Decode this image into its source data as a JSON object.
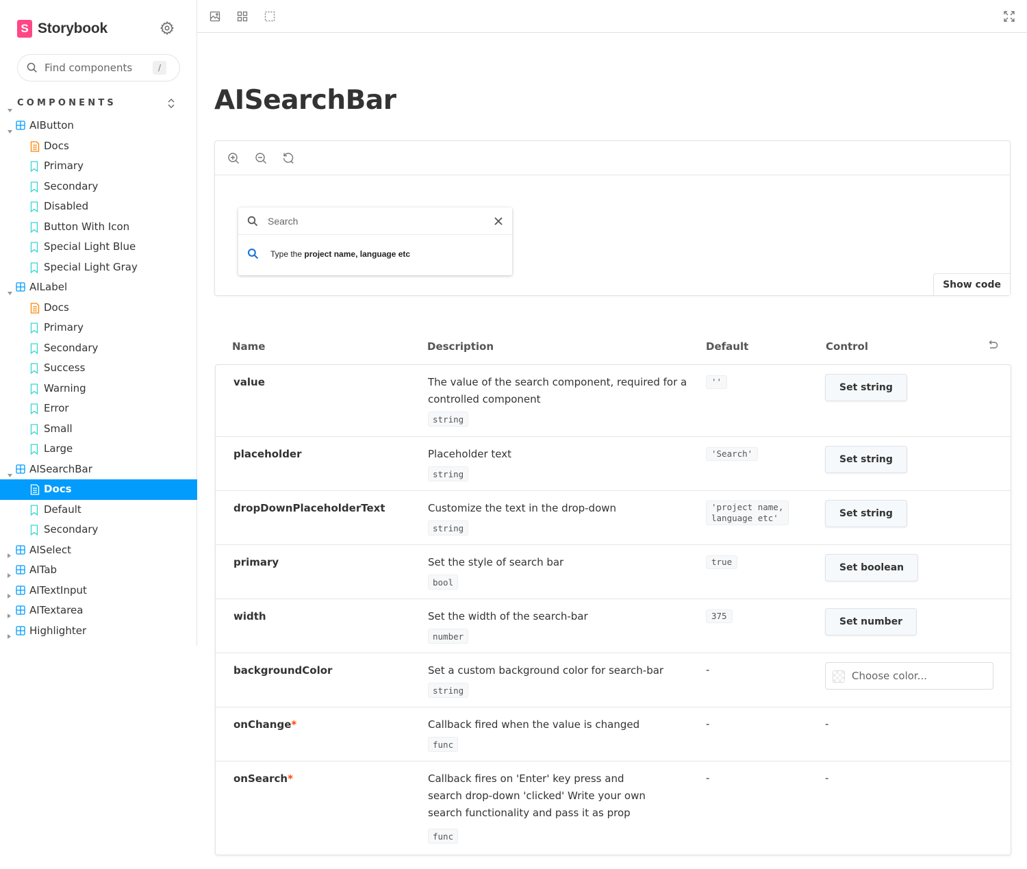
{
  "sidebar": {
    "brand": "Storybook",
    "logo_letter": "S",
    "search_placeholder": "Find components",
    "search_shortcut": "/",
    "section_title": "COMPONENTS",
    "tree": [
      {
        "label": "AIButton",
        "type": "component",
        "level": 0,
        "expanded": true
      },
      {
        "label": "Docs",
        "type": "docs",
        "level": 1
      },
      {
        "label": "Primary",
        "type": "story",
        "level": 1
      },
      {
        "label": "Secondary",
        "type": "story",
        "level": 1
      },
      {
        "label": "Disabled",
        "type": "story",
        "level": 1
      },
      {
        "label": "Button With Icon",
        "type": "story",
        "level": 1
      },
      {
        "label": "Special Light Blue",
        "type": "story",
        "level": 1
      },
      {
        "label": "Special Light Gray",
        "type": "story",
        "level": 1
      },
      {
        "label": "AILabel",
        "type": "component",
        "level": 0,
        "expanded": true
      },
      {
        "label": "Docs",
        "type": "docs",
        "level": 1
      },
      {
        "label": "Primary",
        "type": "story",
        "level": 1
      },
      {
        "label": "Secondary",
        "type": "story",
        "level": 1
      },
      {
        "label": "Success",
        "type": "story",
        "level": 1
      },
      {
        "label": "Warning",
        "type": "story",
        "level": 1
      },
      {
        "label": "Error",
        "type": "story",
        "level": 1
      },
      {
        "label": "Small",
        "type": "story",
        "level": 1
      },
      {
        "label": "Large",
        "type": "story",
        "level": 1
      },
      {
        "label": "AISearchBar",
        "type": "component",
        "level": 0,
        "expanded": true
      },
      {
        "label": "Docs",
        "type": "docs",
        "level": 1,
        "selected": true
      },
      {
        "label": "Default",
        "type": "story",
        "level": 1
      },
      {
        "label": "Secondary",
        "type": "story",
        "level": 1
      },
      {
        "label": "AISelect",
        "type": "component",
        "level": 0,
        "expanded": false
      },
      {
        "label": "AITab",
        "type": "component",
        "level": 0,
        "expanded": false
      },
      {
        "label": "AITextInput",
        "type": "component",
        "level": 0,
        "expanded": false
      },
      {
        "label": "AITextarea",
        "type": "component",
        "level": 0,
        "expanded": false
      },
      {
        "label": "Highlighter",
        "type": "component",
        "level": 0,
        "expanded": false
      }
    ]
  },
  "page": {
    "title": "AISearchBar"
  },
  "preview": {
    "search_placeholder": "Search",
    "hint_prefix": "Type the ",
    "hint_bold": "project name, language etc",
    "show_code": "Show code"
  },
  "args_table": {
    "headers": {
      "name": "Name",
      "description": "Description",
      "default": "Default",
      "control": "Control"
    },
    "rows": [
      {
        "name": "value",
        "required": false,
        "description": "The value of the search component, required for a controlled component",
        "type": "string",
        "default": "''",
        "control": "Set string"
      },
      {
        "name": "placeholder",
        "required": false,
        "description": "Placeholder text",
        "type": "string",
        "default": "'Search'",
        "control": "Set string"
      },
      {
        "name": "dropDownPlaceholderText",
        "required": false,
        "description": "Customize the text in the drop-down",
        "type": "string",
        "default": "'project name,\nlanguage etc'",
        "control": "Set string"
      },
      {
        "name": "primary",
        "required": false,
        "description": "Set the style of search bar",
        "type": "bool",
        "default": "true",
        "control": "Set boolean"
      },
      {
        "name": "width",
        "required": false,
        "description": "Set the width of the search-bar",
        "type": "number",
        "default": "375",
        "control": "Set number"
      },
      {
        "name": "backgroundColor",
        "required": false,
        "description": "Set a custom background color for search-bar",
        "type": "string",
        "default": "-",
        "control_placeholder": "Choose color..."
      },
      {
        "name": "onChange",
        "required": true,
        "required_mark": "*",
        "description": "Callback fired when the value is changed",
        "type": "func",
        "default": "-",
        "control": "-"
      },
      {
        "name": "onSearch",
        "required": true,
        "required_mark": "*",
        "description": "Callback fires on 'Enter' key press and search drop-down 'clicked' Write your own search functionality and pass it as prop",
        "type": "func",
        "default": "-",
        "control": "-"
      }
    ]
  },
  "colors": {
    "brand": "#ff4785",
    "selected": "#029cfd",
    "story_icon": "#37d5d3",
    "docs_icon": "#ff8300",
    "component_icon": "#029cfd",
    "required": "#ff4400"
  }
}
